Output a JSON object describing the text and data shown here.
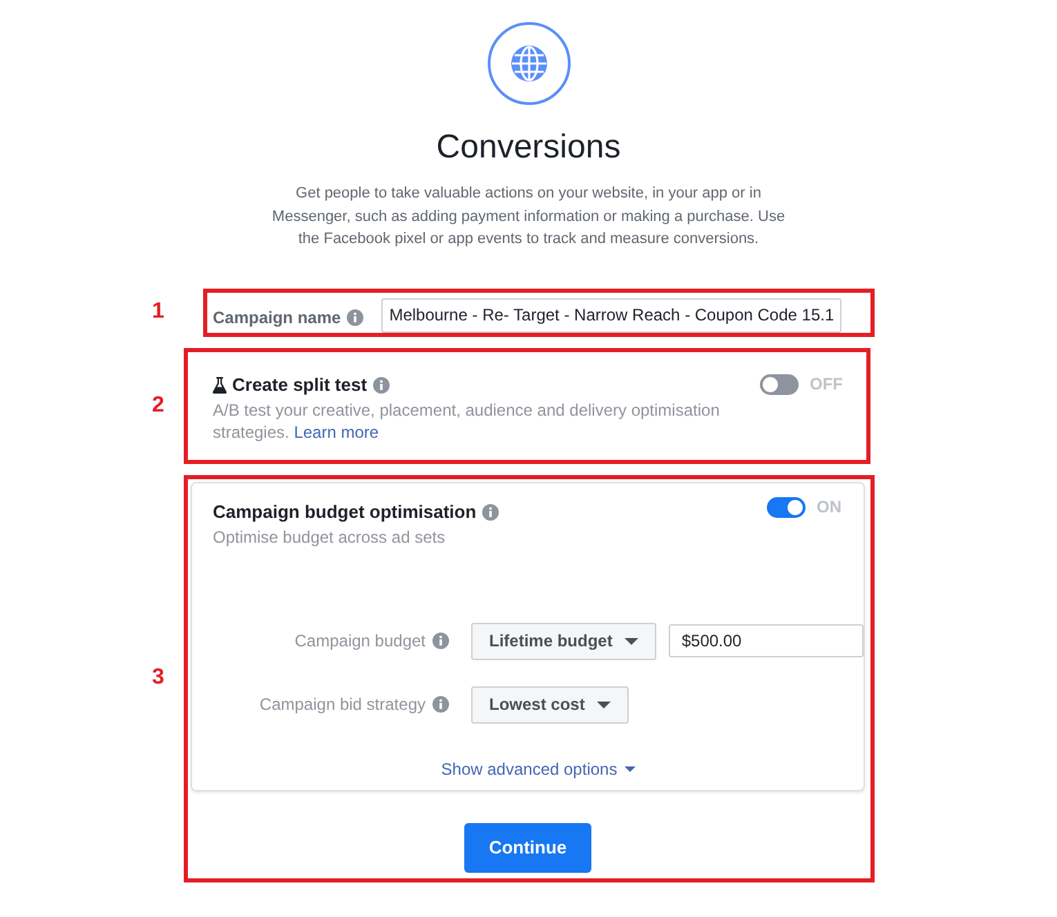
{
  "header": {
    "title": "Conversions",
    "description": "Get people to take valuable actions on your website, in your app or in Messenger, such as adding payment information or making a purchase. Use the Facebook pixel or app events to track and measure conversions."
  },
  "sections": [
    {
      "kind": "name_field",
      "annotation": "1",
      "label": "Campaign name",
      "value": "Melbourne - Re- Target - Narrow Reach - Coupon Code 15.1"
    },
    {
      "kind": "split_test",
      "annotation": "2",
      "title": "Create split test",
      "description": "A/B test your creative, placement, audience and delivery optimisation strategies.",
      "link": "Learn more",
      "toggle": {
        "on": false,
        "label": "OFF"
      }
    },
    {
      "kind": "budget",
      "annotation": "3",
      "title": "Campaign budget optimisation",
      "description": "Optimise budget across ad sets",
      "toggle": {
        "on": true,
        "label": "ON"
      },
      "fields": [
        {
          "label": "Campaign budget",
          "dropdown": "Lifetime budget",
          "value": "$500.00"
        },
        {
          "label": "Campaign bid strategy",
          "dropdown": "Lowest cost"
        }
      ],
      "advanced_link": "Show advanced options",
      "button": "Continue"
    }
  ]
}
